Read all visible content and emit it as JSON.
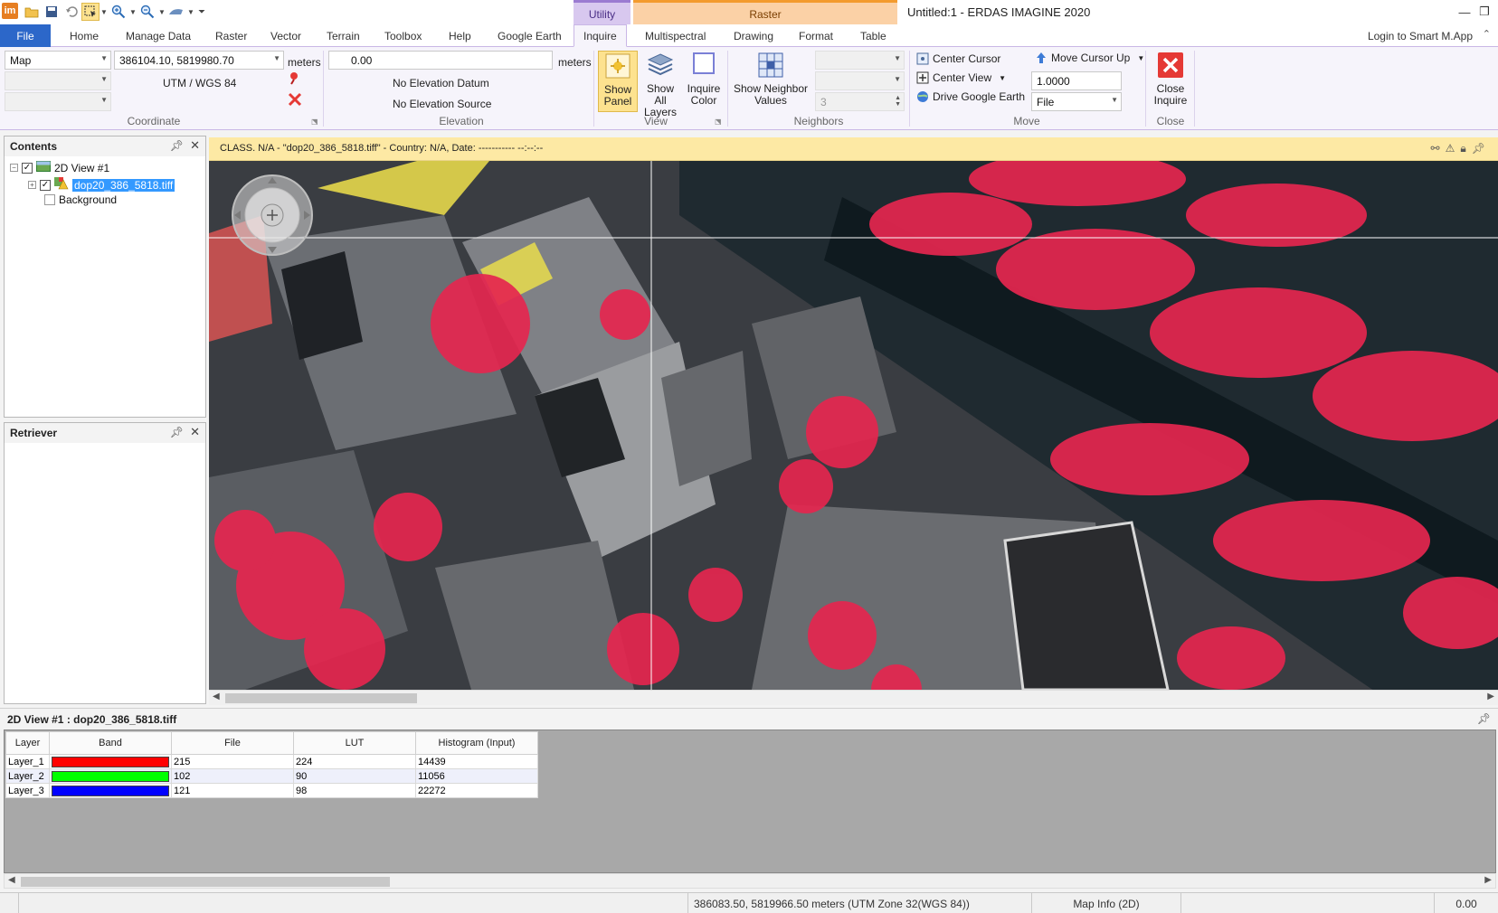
{
  "title_bar": {
    "app_icon": "im",
    "window_title": "Untitled:1 - ERDAS IMAGINE 2020",
    "quick_access_icons": [
      "open-folder-icon",
      "save-icon",
      "undo-icon",
      "select-icon",
      "zoom-in-icon",
      "zoom-out-icon",
      "pan-icon",
      "customize-icon"
    ],
    "window_controls": [
      "minimize-icon",
      "restore-icon",
      "close-icon"
    ]
  },
  "contextual_groups": {
    "utility": "Utility",
    "raster": "Raster"
  },
  "tabs": {
    "file": "File",
    "items": [
      "Home",
      "Manage Data",
      "Raster",
      "Vector",
      "Terrain",
      "Toolbox",
      "Help",
      "Google Earth",
      "Inquire",
      "Multispectral",
      "Drawing",
      "Format",
      "Table"
    ],
    "active": "Inquire",
    "login": "Login to Smart M.App"
  },
  "ribbon": {
    "coordinate": {
      "type_value": "Map",
      "xy_value": "386104.10,  5819980.70",
      "units": "meters",
      "projection": "UTM / WGS 84",
      "label": "Coordinate"
    },
    "elevation": {
      "value": "0.00",
      "units": "meters",
      "datum": "No Elevation Datum",
      "source": "No Elevation Source",
      "label": "Elevation"
    },
    "view": {
      "show_panel": "Show Panel",
      "show_all_layers": "Show All Layers",
      "inquire_color": "Inquire Color",
      "label": "View"
    },
    "neighbors": {
      "show_neighbor_values": "Show Neighbor Values",
      "size_value": "3",
      "label": "Neighbors"
    },
    "move": {
      "center_cursor": "Center Cursor",
      "center_view": "Center View",
      "drive_google_earth": "Drive Google Earth",
      "move_cursor_up": "Move Cursor Up",
      "step_value": "1.0000",
      "step_mode": "File",
      "label": "Move"
    },
    "close": {
      "close_inquire": "Close Inquire",
      "label": "Close"
    }
  },
  "contents_panel": {
    "title": "Contents",
    "view_name": "2D View #1",
    "layer_name": "dop20_386_5818.tiff",
    "background": "Background"
  },
  "retriever_panel": {
    "title": "Retriever"
  },
  "view_info": "CLASS. N/A - \"dop20_386_5818.tiff\" - Country: N/A, Date: ----------- --:--:--",
  "inquire_panel": {
    "title": "2D View #1 : dop20_386_5818.tiff",
    "columns": [
      "Layer",
      "Band",
      "File",
      "LUT",
      "Histogram (Input)"
    ],
    "rows": [
      {
        "layer": "Layer_1",
        "band_color": "#ff0000",
        "file": "215",
        "lut": "224",
        "histogram": "14439"
      },
      {
        "layer": "Layer_2",
        "band_color": "#00ff00",
        "file": "102",
        "lut": "90",
        "histogram": "11056"
      },
      {
        "layer": "Layer_3",
        "band_color": "#0000ff",
        "file": "121",
        "lut": "98",
        "histogram": "22272"
      }
    ]
  },
  "status_bar": {
    "coords": "386083.50, 5819966.50 meters (UTM Zone 32(WGS 84))",
    "map_info": "Map Info (2D)",
    "value": "0.00"
  },
  "colors": {
    "accent": "#2c67c9",
    "utility_tab": "#d8c8ef",
    "raster_tab": "#fbd1a6",
    "info_bar": "#fde9a4"
  }
}
